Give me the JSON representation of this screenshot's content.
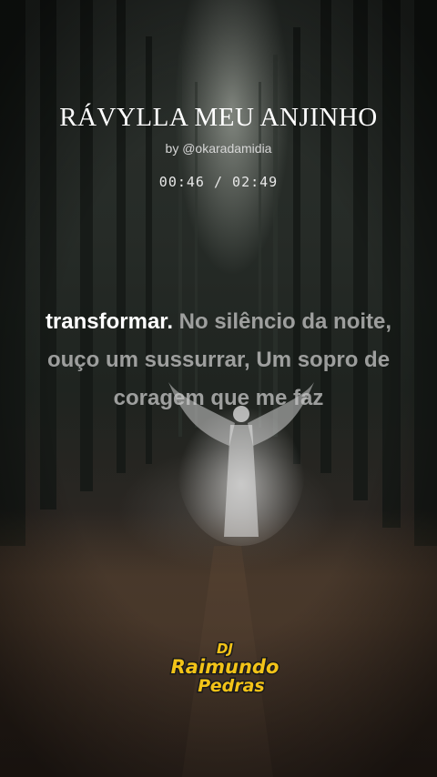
{
  "song": {
    "title": "RÁVYLLA MEU ANJINHO",
    "artist_handle": "by @okaradamidia"
  },
  "player": {
    "position": "00:46",
    "separator": " / ",
    "duration": "02:49"
  },
  "lyrics": {
    "current_word": "transformar.",
    "upcoming": " No silêncio da noite, ouço um sussurrar, Um sopro de coragem que me faz"
  },
  "watermark": {
    "line1": "DJ",
    "line2": "Raimundo",
    "line3": "Pedras"
  },
  "colors": {
    "title": "#ffffff",
    "lyric_current": "#ffffff",
    "lyric_upcoming": "#c8c8c8",
    "logo_fill": "#f2c318",
    "logo_outline": "#1a1a1a"
  }
}
